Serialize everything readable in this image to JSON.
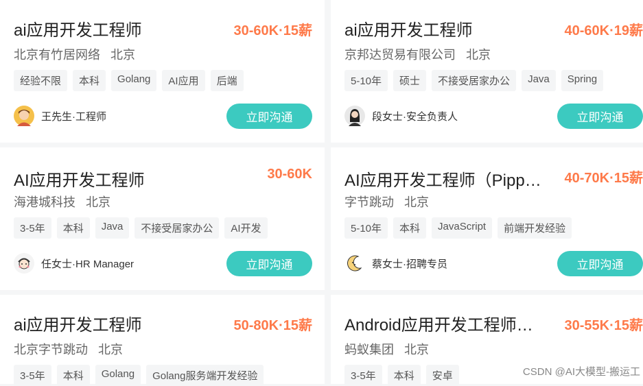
{
  "jobs": [
    {
      "title": "ai应用开发工程师",
      "salary": "30-60K·15薪",
      "company": "北京有竹居网络",
      "city": "北京",
      "tags": [
        "经验不限",
        "本科",
        "Golang",
        "AI应用",
        "后端"
      ],
      "recruiter": "王先生·工程师",
      "avatar_icon": "man-avatar-icon",
      "button": "立即沟通"
    },
    {
      "title": "ai应用开发工程师",
      "salary": "40-60K·19薪",
      "company": "京邦达贸易有限公司",
      "city": "北京",
      "tags": [
        "5-10年",
        "硕士",
        "不接受居家办公",
        "Java",
        "Spring"
      ],
      "recruiter": "段女士·安全负责人",
      "avatar_icon": "woman-avatar-icon",
      "button": "立即沟通"
    },
    {
      "title": "AI应用开发工程师",
      "salary": "30-60K",
      "company": "海港城科技",
      "city": "北京",
      "tags": [
        "3-5年",
        "本科",
        "Java",
        "不接受居家办公",
        "AI开发"
      ],
      "recruiter": "任女士·HR Manager",
      "avatar_icon": "cartoon-avatar-icon",
      "button": "立即沟通"
    },
    {
      "title": "AI应用开发工程师（Pippit…",
      "salary": "40-70K·15薪",
      "company": "字节跳动",
      "city": "北京",
      "tags": [
        "5-10年",
        "本科",
        "JavaScript",
        "前端开发经验"
      ],
      "recruiter": "蔡女士·招聘专员",
      "avatar_icon": "moon-avatar-icon",
      "button": "立即沟通"
    },
    {
      "title": "ai应用开发工程师",
      "salary": "50-80K·15薪",
      "company": "北京字节跳动",
      "city": "北京",
      "tags": [
        "3-5年",
        "本科",
        "Golang",
        "Golang服务端开发经验"
      ]
    },
    {
      "title": "Android应用开发工程师（…",
      "salary": "30-55K·15薪",
      "company": "蚂蚁集团",
      "city": "北京",
      "tags": [
        "3-5年",
        "本科",
        "安卓"
      ]
    }
  ],
  "watermark": "CSDN @AI大模型-搬运工",
  "colors": {
    "accent": "#3ccac0",
    "salary": "#fe7a4a"
  }
}
